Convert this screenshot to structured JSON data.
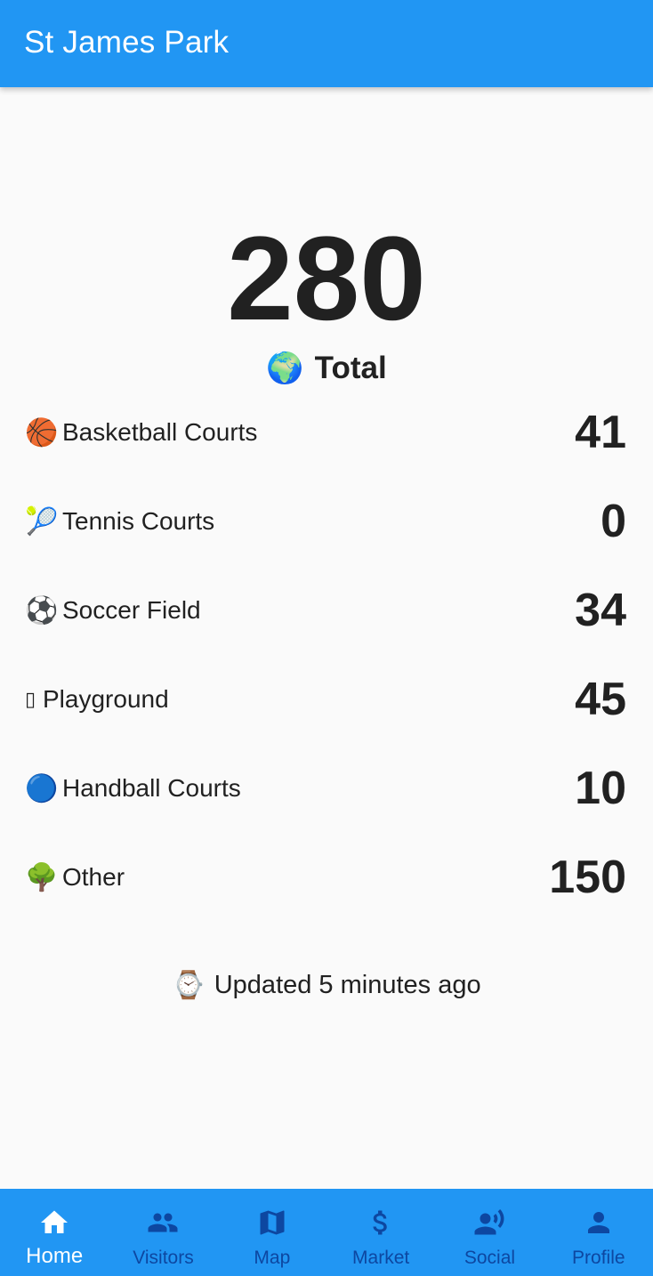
{
  "app_bar": {
    "title": "St James Park"
  },
  "total": {
    "value": "280",
    "emoji": "🌍",
    "label": "Total"
  },
  "rows": [
    {
      "emoji": "🏀",
      "label": "Basketball Courts",
      "value": "41"
    },
    {
      "emoji": "🎾",
      "label": "Tennis Courts",
      "value": "0"
    },
    {
      "emoji": "⚽",
      "label": "Soccer Field",
      "value": "34"
    },
    {
      "emoji": "▯",
      "label": "Playground",
      "value": "45"
    },
    {
      "emoji": "🔵",
      "label": "Handball Courts",
      "value": "10"
    },
    {
      "emoji": "🌳",
      "label": "Other",
      "value": "150"
    }
  ],
  "updated": {
    "emoji": "⌚",
    "text": "Updated 5 minutes ago"
  },
  "nav": {
    "items": [
      {
        "label": "Home",
        "icon": "home-icon",
        "active": true
      },
      {
        "label": "Visitors",
        "icon": "people-icon",
        "active": false
      },
      {
        "label": "Map",
        "icon": "map-icon",
        "active": false
      },
      {
        "label": "Market",
        "icon": "dollar-icon",
        "active": false
      },
      {
        "label": "Social",
        "icon": "record-voice-icon",
        "active": false
      },
      {
        "label": "Profile",
        "icon": "person-icon",
        "active": false
      }
    ]
  },
  "colors": {
    "primary": "#2196f3",
    "nav_inactive": "#0d47a1",
    "nav_active": "#ffffff",
    "text": "#212121",
    "background": "#fafafa"
  }
}
